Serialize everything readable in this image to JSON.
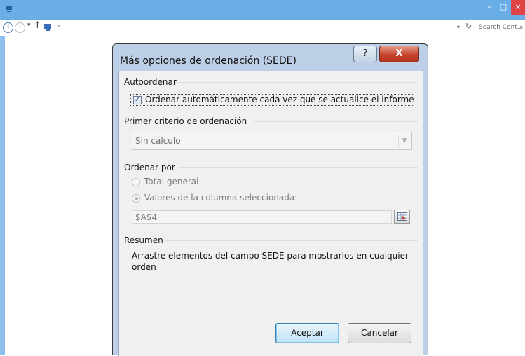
{
  "explorer": {
    "minimize_glyph": "–",
    "maximize_glyph": "□",
    "close_glyph": "×",
    "history_glyph": "▾",
    "up_glyph": "↑",
    "crumb_glyph": "›",
    "dropdown_glyph": "▾",
    "refresh_glyph": "↻",
    "search_placeholder": "Search Cont...",
    "search_icon": "⌕",
    "back_icon": "‹",
    "forward_icon": "›"
  },
  "dialog": {
    "title": "Más opciones de ordenación (SEDE)",
    "help_glyph": "?",
    "close_glyph": "X",
    "autosort": {
      "section_label": "Autoordenar",
      "checkbox_label": "Ordenar automáticamente cada vez que se actualice el informe",
      "checked": true,
      "check_glyph": "✓"
    },
    "primary_key": {
      "section_label": "Primer criterio de ordenación",
      "selected": "Sin cálculo",
      "arrow_glyph": "▼"
    },
    "sort_by": {
      "section_label": "Ordenar por",
      "options": [
        {
          "label": "Total general",
          "selected": false
        },
        {
          "label": "Valores de la columna seleccionada:",
          "selected": true
        }
      ],
      "reference": "$A$4"
    },
    "summary": {
      "section_label": "Resumen",
      "text": "Arrastre elementos del campo SEDE para mostrarlos en cualquier orden"
    },
    "buttons": {
      "ok": "Aceptar",
      "cancel": "Cancelar"
    }
  },
  "colors": {
    "titlebar": "#6aaee8",
    "dialog_frame": "#bccfe6",
    "close_button": "#c5442d"
  }
}
